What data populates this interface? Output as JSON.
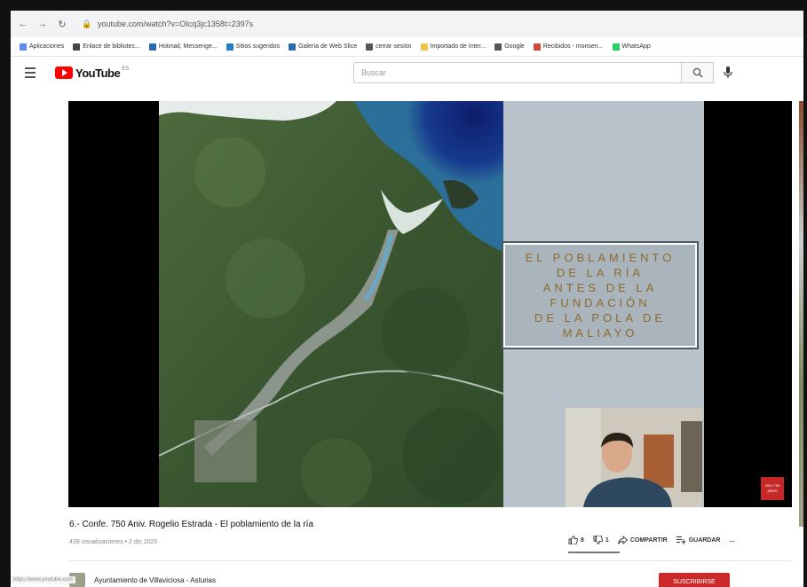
{
  "browser": {
    "url": "youtube.com/watch?v=OIcq3jc1358t=2397s",
    "bookmarks": [
      {
        "label": "Aplicaciones",
        "color": "#5b8def"
      },
      {
        "label": "Enlace de bibliotec...",
        "color": "#444"
      },
      {
        "label": "Hotmail, Messenge...",
        "color": "#2a6bb0"
      },
      {
        "label": "Sitios sugeridos",
        "color": "#1f7fc9"
      },
      {
        "label": "Galería de Web Slice",
        "color": "#2a6bb0"
      },
      {
        "label": "cerrar sesión",
        "color": "#555"
      },
      {
        "label": "Importado de Inter...",
        "color": "#f2c24b"
      },
      {
        "label": "Google",
        "color": "#555"
      },
      {
        "label": "Recibidos - monsen...",
        "color": "#d44638"
      },
      {
        "label": "WhatsApp",
        "color": "#25d366"
      }
    ]
  },
  "header": {
    "logo_text": "YouTube",
    "logo_sup": "ES",
    "search_placeholder": "Buscar"
  },
  "video": {
    "slide_title_lines": [
      "EL POBLAMIENTO",
      "DE LA RÍA",
      "ANTES DE LA",
      "FUNDACIÓN",
      "DE LA POLA DE",
      "MALIAYO"
    ],
    "corner_logo": "2021 750 AÑOS",
    "title": "6.- Confe. 750 Aniv. Rogelio Estrada - El poblamiento de la ría",
    "meta": "439 visualizaciones • 2 dic 2020",
    "likes": "8",
    "dislikes": "1",
    "share_label": "COMPARTIR",
    "save_label": "GUARDAR",
    "more_label": "..."
  },
  "channel": {
    "name": "Ayuntamiento de Villaviciosa - Asturias",
    "subscribe_label": "SUSCRIBIRSE"
  },
  "status_bar": "https://www.youtube.com",
  "colors": {
    "youtube_red": "#ff0000",
    "slide_text": "#8f6a2c",
    "subscribe": "#cc2a2a"
  }
}
